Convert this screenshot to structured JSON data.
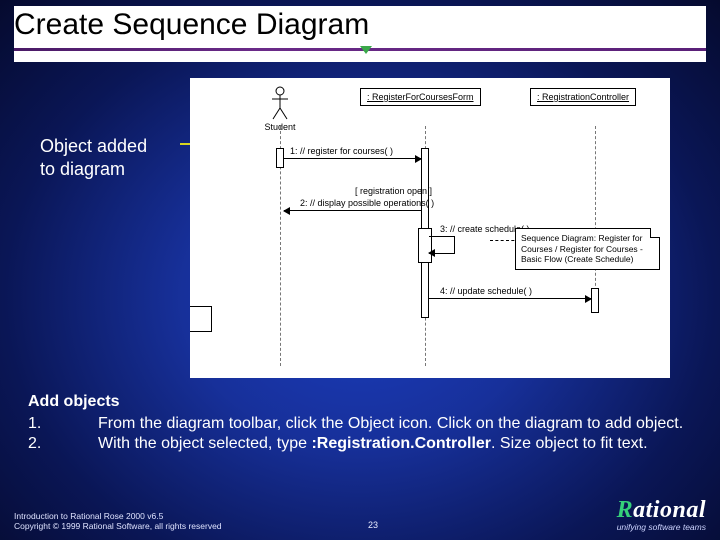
{
  "title": "Create Sequence Diagram",
  "callout": "Object added\nto diagram",
  "diagram": {
    "actor_label": "Student",
    "object1": ": RegisterForCoursesForm",
    "object2": ": RegistrationController",
    "msg1": "1: // register for courses( )",
    "guard": "[ registration open ]",
    "msg2": "2: // display possible operations( )",
    "msg3": "3: // create schedule( )",
    "msg4": "4: // update schedule( )",
    "note": "Sequence Diagram: Register for Courses / Register for Courses - Basic Flow (Create Schedule)"
  },
  "body": {
    "heading": "Add objects",
    "step1_num": "1.",
    "step1_txt_a": "From the diagram toolbar, click the Object icon. Click on the diagram to add object.",
    "step2_num": "2.",
    "step2_txt_a": "With the object selected, type ",
    "step2_bold": ":Registration.Controller",
    "step2_txt_b": ". Size object to fit text."
  },
  "footer": {
    "line1": "Introduction to Rational Rose 2000 v6.5",
    "line2": "Copyright © 1999 Rational Software, all rights reserved"
  },
  "slide_number": "23",
  "logo": {
    "brand_prefix": "R",
    "brand_rest": "ational",
    "tagline": "unifying software teams"
  }
}
